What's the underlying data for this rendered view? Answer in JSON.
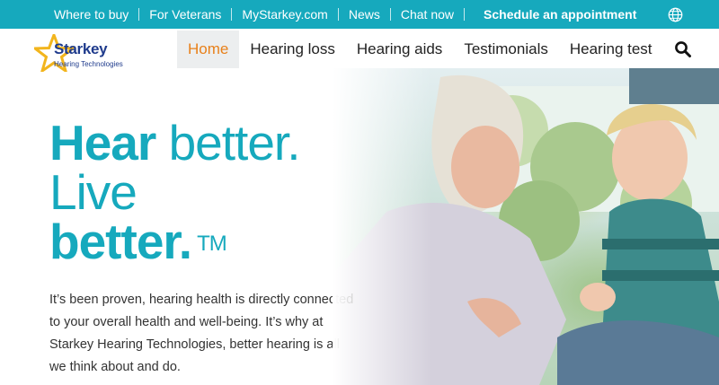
{
  "topbar": {
    "links": [
      "Where to buy",
      "For Veterans",
      "MyStarkey.com",
      "News",
      "Chat now"
    ],
    "appointment": "Schedule an appointment",
    "globe_icon": "globe-icon",
    "background": "#16a9bd"
  },
  "logo": {
    "brand": "Starkey",
    "tagline": "Hearing Technologies",
    "star_color": "#f2b51d"
  },
  "nav": {
    "items": [
      "Home",
      "Hearing loss",
      "Hearing aids",
      "Testimonials",
      "Hearing test"
    ],
    "active": "Home",
    "active_color": "#e8801a",
    "search_icon": "search-icon"
  },
  "hero": {
    "headline_line1_bold": "Hear",
    "headline_line1_light": " better.",
    "headline_line2": "Live",
    "headline_line3": "better.",
    "trademark": "TM",
    "body": "It’s been proven, hearing health is directly connected to your overall health and well-being. It’s why at Starkey Hearing Technologies, better hearing is all we think about and do.",
    "accent": "#16a9bd"
  }
}
